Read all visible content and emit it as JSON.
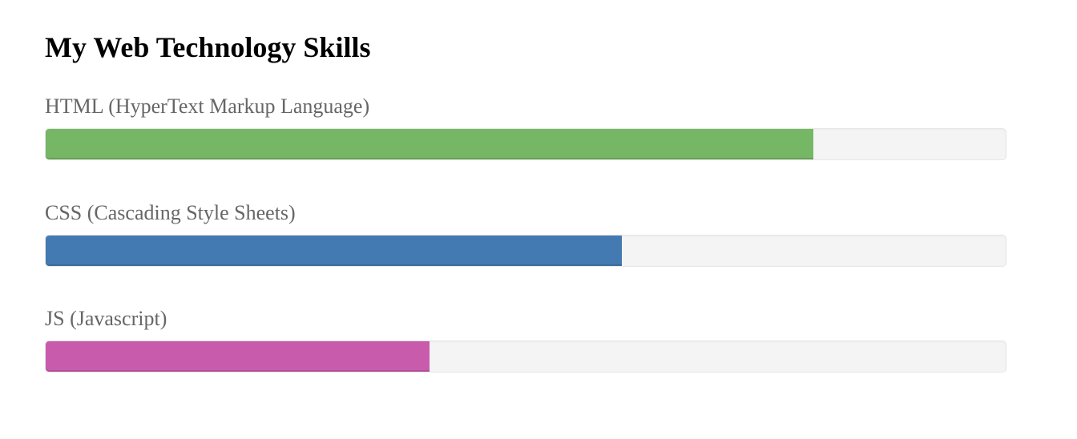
{
  "page": {
    "title": "My Web Technology Skills"
  },
  "skills": [
    {
      "label": "HTML (HyperText Markup Language)",
      "level": 0.8,
      "color": "#76b765"
    },
    {
      "label": "CSS (Cascading Style Sheets)",
      "level": 0.6,
      "color": "#447ab2"
    },
    {
      "label": "JS (Javascript)",
      "level": 0.4,
      "color": "#c95bad"
    }
  ]
}
